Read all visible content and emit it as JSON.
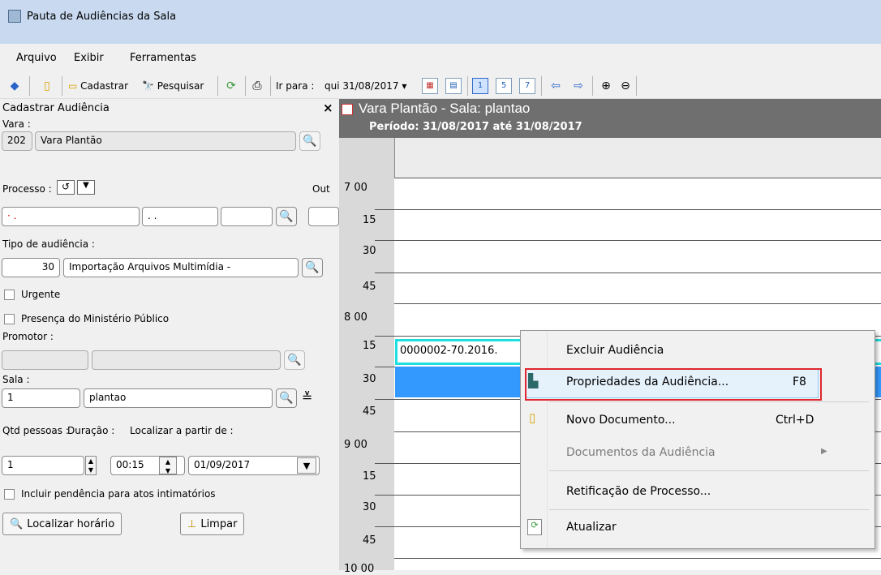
{
  "window": {
    "title": "Pauta de Audiências da Sala"
  },
  "menu": [
    "Arquivo",
    "Exibir",
    "Ferramentas"
  ],
  "toolbar": {
    "cadastrar": "Cadastrar",
    "pesquisar": "Pesquisar",
    "ir_para_label": "Ir para :",
    "ir_para_value": "qui 31/08/2017",
    "view_buttons": [
      "1",
      "5",
      "7"
    ]
  },
  "panel": {
    "title": "Cadastrar Audiência",
    "close": "×",
    "vara_label": "Vara :",
    "vara_code": "202",
    "vara_name": "Vara Plantão",
    "processo_label": "Processo :",
    "processo_out": "Out",
    "processo_value": "· .",
    "processo_mid": ". .",
    "tipo_label": "Tipo de audiência :",
    "tipo_code": "30",
    "tipo_name": "Importação Arquivos Multimídia -",
    "urgente": "Urgente",
    "presenca": "Presença do Ministério Público",
    "promotor_label": "Promotor :",
    "sala_label": "Sala :",
    "sala_code": "1",
    "sala_name": "plantao",
    "qtd_label": "Qtd pessoas :",
    "qtd_value": "1",
    "duracao_label": "Duração :",
    "duracao_value": "00:15",
    "localizar_label": "Localizar a partir de :",
    "localizar_value": "01/09/2017",
    "incluir": "Incluir pendência para atos intimatórios",
    "btn_localizar": "Localizar horário",
    "btn_limpar": "Limpar"
  },
  "schedule": {
    "title": "Vara Plantão - Sala: plantao",
    "periodo": "Período: 31/08/2017 até 31/08/2017",
    "times": [
      "7 00",
      "15",
      "30",
      "45",
      "8 00",
      "15",
      "30",
      "45",
      "9 00",
      "15",
      "30",
      "45",
      "10 00"
    ],
    "event_text": "0000002-70.2016."
  },
  "context_menu": {
    "items": [
      {
        "label": "Excluir Audiência",
        "shortcut": ""
      },
      {
        "label": "Propriedades da Audiência...",
        "shortcut": "F8"
      },
      {
        "label": "Novo Documento...",
        "shortcut": "Ctrl+D"
      },
      {
        "label": "Documentos da Audiência",
        "shortcut": ""
      },
      {
        "label": "Retificação de Processo...",
        "shortcut": ""
      },
      {
        "label": "Atualizar",
        "shortcut": ""
      }
    ],
    "highlight_color": "#e0262f"
  }
}
